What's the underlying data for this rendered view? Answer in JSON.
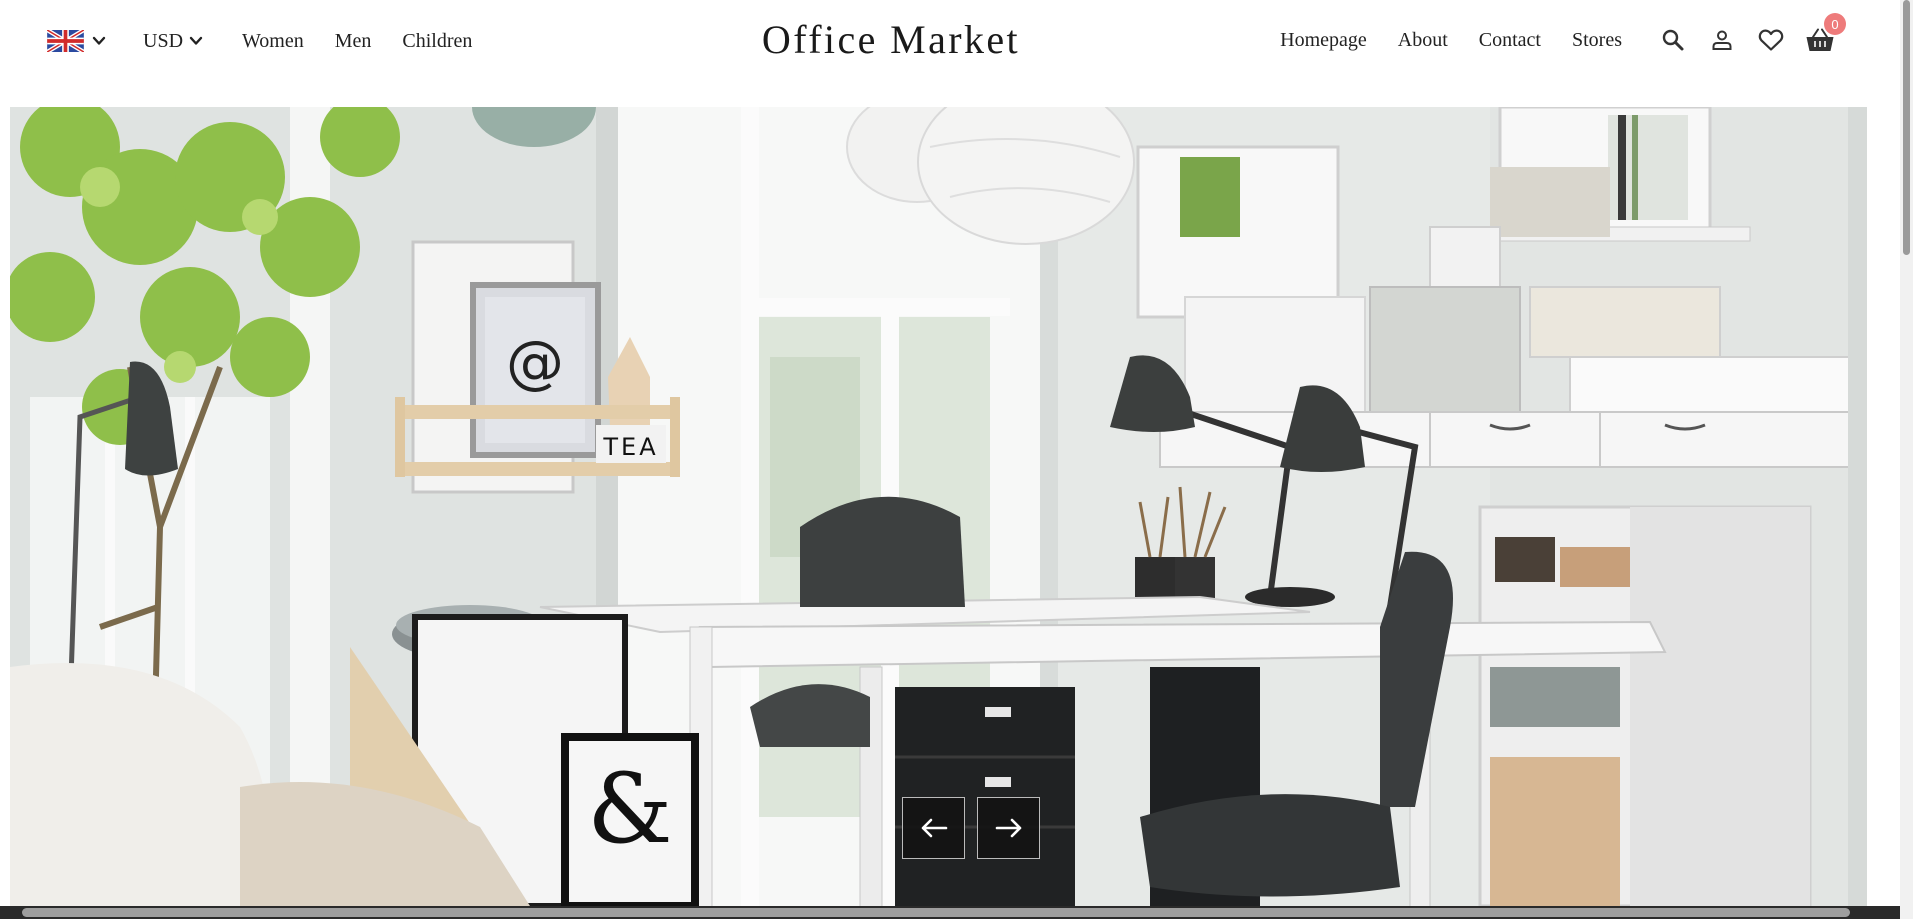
{
  "header": {
    "language_flag": "uk-flag-icon",
    "currency": "USD",
    "nav_left": [
      {
        "label": "Women"
      },
      {
        "label": "Men"
      },
      {
        "label": "Children"
      }
    ],
    "logo": "Office Market",
    "nav_right": [
      {
        "label": "Homepage"
      },
      {
        "label": "About"
      },
      {
        "label": "Contact"
      },
      {
        "label": "Stores"
      }
    ],
    "icons": [
      "search-icon",
      "user-icon",
      "heart-icon",
      "basket-icon"
    ],
    "cart_count": "0"
  },
  "hero": {
    "description": "home-office-scene-image",
    "frame_letters": [
      "@",
      "TEA",
      "&"
    ],
    "controls": {
      "prev": "arrow-left-icon",
      "next": "arrow-right-icon"
    }
  },
  "colors": {
    "badge": "#ee7b7b",
    "arrow_bg": "#141414",
    "text": "#222222"
  }
}
